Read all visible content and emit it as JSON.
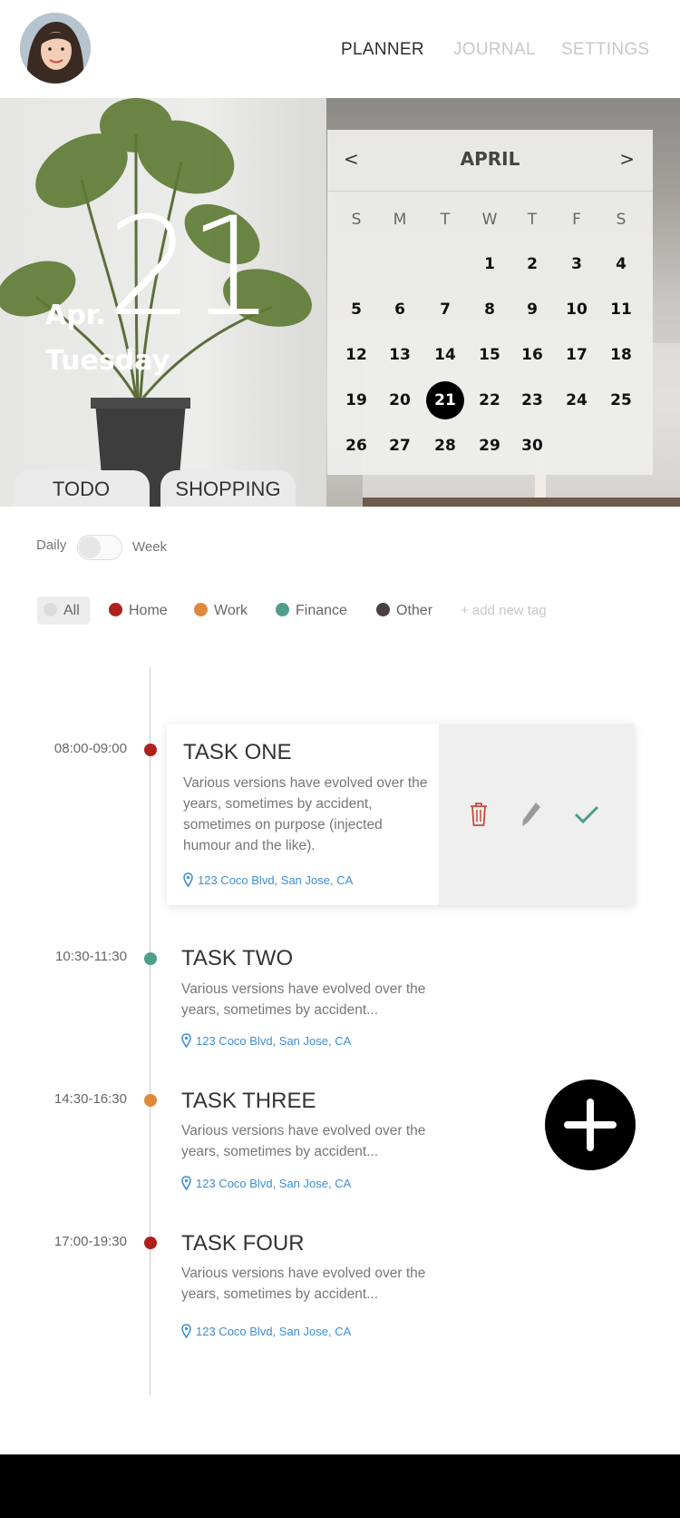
{
  "header": {
    "nav": [
      {
        "label": "PLANNER",
        "active": true
      },
      {
        "label": "JOURNAL",
        "active": false
      },
      {
        "label": "SETTINGS",
        "active": false
      }
    ]
  },
  "hero": {
    "day": "21",
    "month": "Apr.",
    "weekday": "Tuesday"
  },
  "calendar": {
    "month": "APRIL",
    "prev": "<",
    "next": ">",
    "dow": [
      "S",
      "M",
      "T",
      "W",
      "T",
      "F",
      "S"
    ],
    "selected": "21",
    "weeks": [
      [
        "",
        "",
        "",
        "1",
        "2",
        "3",
        "4"
      ],
      [
        "5",
        "6",
        "7",
        "8",
        "9",
        "10",
        "11"
      ],
      [
        "12",
        "13",
        "14",
        "15",
        "16",
        "17",
        "18"
      ],
      [
        "19",
        "20",
        "21",
        "22",
        "23",
        "24",
        "25"
      ],
      [
        "26",
        "27",
        "28",
        "29",
        "30",
        "",
        ""
      ]
    ]
  },
  "tabs": [
    "TODO",
    "SHOPPING"
  ],
  "view": {
    "left": "Daily",
    "right": "Week"
  },
  "tags": [
    {
      "label": "All",
      "color": "#dcdcdc"
    },
    {
      "label": "Home",
      "color": "#b0201a"
    },
    {
      "label": "Work",
      "color": "#e0893a"
    },
    {
      "label": "Finance",
      "color": "#4f9e8c"
    },
    {
      "label": "Other",
      "color": "#4a4040"
    }
  ],
  "add_tag": "+ add new tag",
  "tasks": [
    {
      "time": "08:00-09:00",
      "title": "TASK ONE",
      "color": "#b0201a",
      "desc": "Various versions have evolved over the years, sometimes by accident, sometimes on purpose (injected humour and the like).",
      "location": "123 Coco Blvd, San Jose, CA"
    },
    {
      "time": "10:30-11:30",
      "title": "TASK TWO",
      "color": "#4f9e8c",
      "desc": "Various versions have evolved over the years, sometimes by accident...",
      "location": "123 Coco Blvd, San Jose, CA"
    },
    {
      "time": "14:30-16:30",
      "title": "TASK THREE",
      "color": "#e0893a",
      "desc": "Various versions have evolved over the years, sometimes by accident...",
      "location": "123 Coco Blvd, San Jose, CA"
    },
    {
      "time": "17:00-19:30",
      "title": "TASK FOUR",
      "color": "#b0201a",
      "desc": "Various versions have evolved over the years, sometimes by accident...",
      "location": "123 Coco Blvd, San Jose, CA"
    }
  ],
  "icons": {
    "delete": "trash-icon",
    "edit": "pencil-icon",
    "done": "check-icon",
    "add": "plus-icon",
    "location": "pin-icon"
  }
}
